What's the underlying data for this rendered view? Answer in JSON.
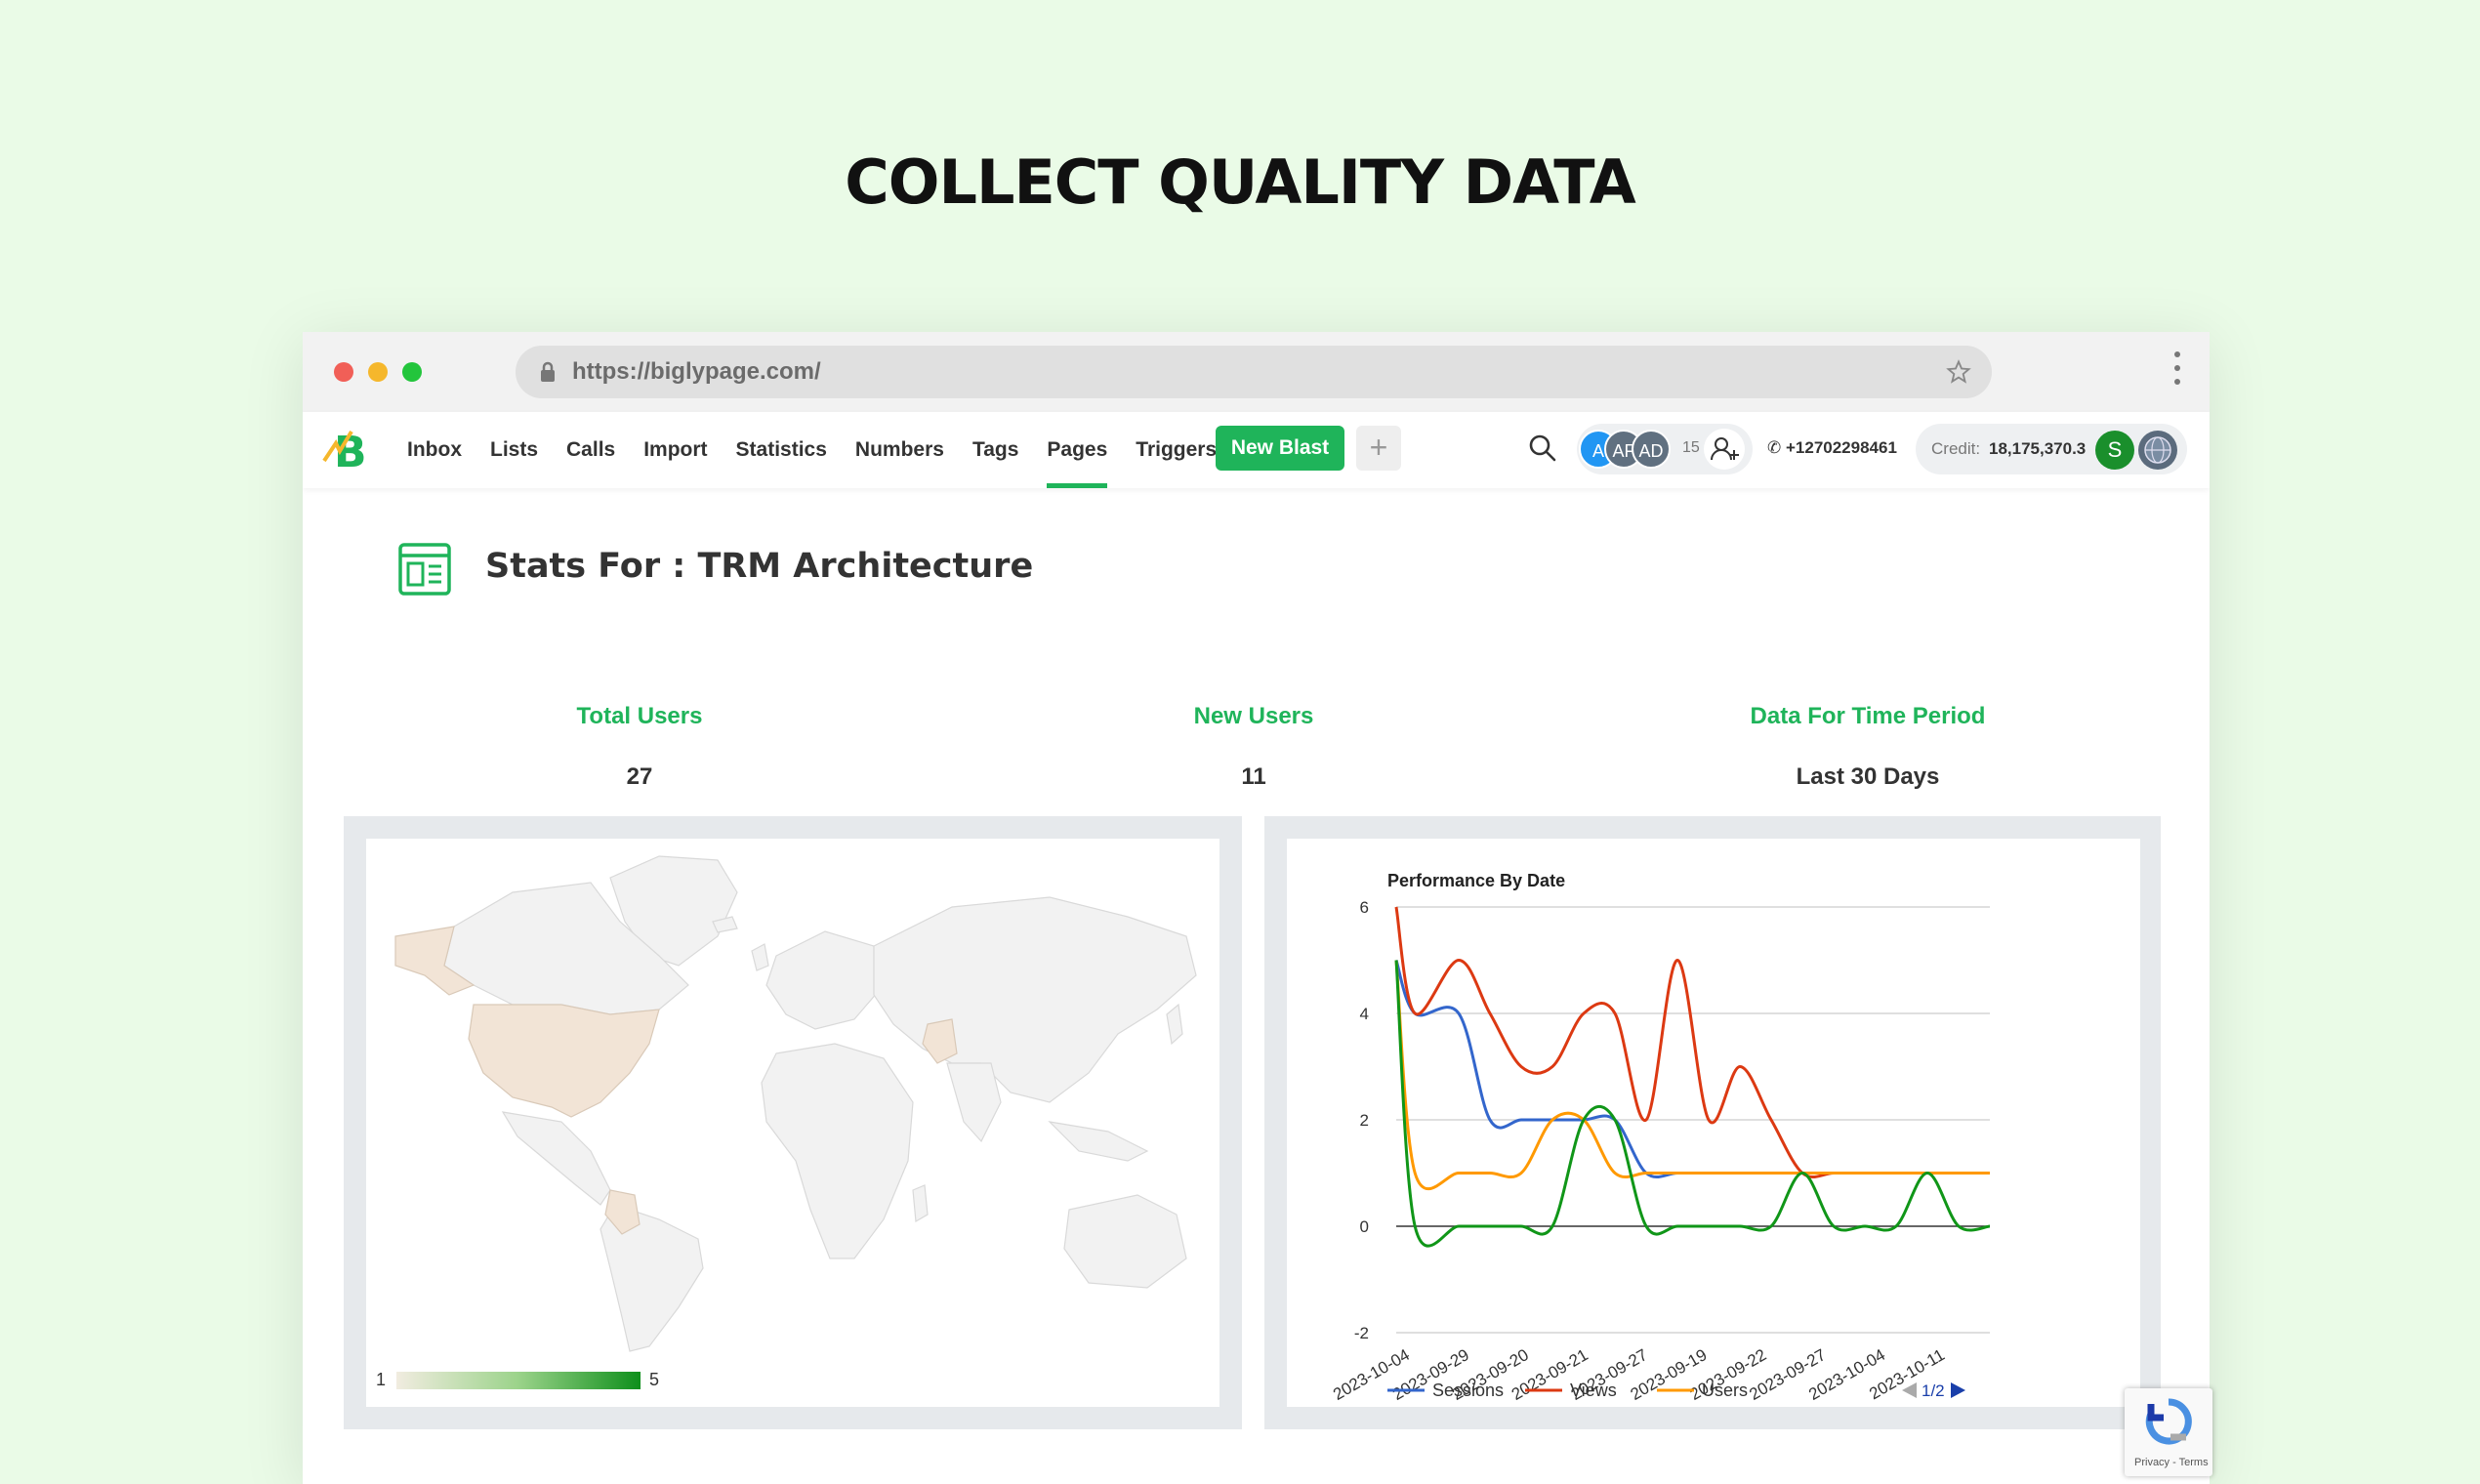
{
  "hero": {
    "title": "COLLECT QUALITY DATA"
  },
  "browser": {
    "url": "https://biglypage.com/"
  },
  "nav": {
    "items": [
      "Inbox",
      "Lists",
      "Calls",
      "Import",
      "Statistics",
      "Numbers",
      "Tags",
      "Pages",
      "Triggers"
    ],
    "active": "Pages",
    "new_blast_label": "New Blast",
    "plus_label": "+",
    "team_avatars": [
      "A",
      "AF",
      "AD"
    ],
    "team_count": "15",
    "phone": "+12702298461",
    "credit_label": "Credit:",
    "credit_value": "18,175,370.3",
    "user_initial": "S"
  },
  "page": {
    "title": "Stats For : TRM Architecture"
  },
  "stats": [
    {
      "label": "Total Users",
      "value": "27"
    },
    {
      "label": "New Users",
      "value": "11"
    },
    {
      "label": "Data For Time Period",
      "value": "Last 30 Days"
    }
  ],
  "map": {
    "legend_min": "1",
    "legend_max": "5",
    "highlighted_countries": [
      "Alaska/USA",
      "United States",
      "Pakistan",
      "Colombia"
    ]
  },
  "chart_data": {
    "type": "line",
    "title": "Performance By Date",
    "x": [
      "2023-10-04",
      "2023-09-29",
      "2023-09-20",
      "2023-09-21",
      "2023-09-27",
      "2023-09-19",
      "2023-09-22",
      "2023-09-27",
      "2023-10-04",
      "2023-10-11"
    ],
    "x_numeric": [
      0,
      0.3,
      1,
      1.5,
      2,
      2.5,
      3,
      3.5,
      4,
      4.5,
      5,
      5.5,
      6,
      6.5,
      7,
      7.5,
      8,
      8.5,
      9,
      9.5
    ],
    "ylim": [
      -2,
      6
    ],
    "yticks": [
      6,
      4,
      2,
      0,
      -2
    ],
    "grid": true,
    "legend_position": "bottom",
    "legend_page": "1/2",
    "series": [
      {
        "name": "Sessions",
        "color": "#3366cc",
        "values": [
          5,
          4,
          4,
          2,
          2,
          2,
          2,
          2,
          1,
          1,
          1,
          1,
          1,
          1,
          1,
          1,
          1,
          1,
          1,
          1
        ]
      },
      {
        "name": "Views",
        "color": "#dc3912",
        "values": [
          6,
          4,
          5,
          4,
          3,
          3,
          4,
          4,
          2,
          5,
          2,
          3,
          2,
          1,
          1,
          1,
          1,
          1,
          1,
          1
        ]
      },
      {
        "name": "Users",
        "color": "#ff9900",
        "values": [
          5,
          1,
          1,
          1,
          1,
          2,
          2,
          1,
          1,
          1,
          1,
          1,
          1,
          1,
          1,
          1,
          1,
          1,
          1,
          1
        ]
      },
      {
        "name": "",
        "color": "#109618",
        "values": [
          5,
          0,
          0,
          0,
          0,
          0,
          2,
          2,
          0,
          0,
          0,
          0,
          0,
          1,
          0,
          0,
          0,
          1,
          0,
          0
        ]
      }
    ]
  },
  "recaptcha": {
    "text": "Privacy - Terms"
  }
}
